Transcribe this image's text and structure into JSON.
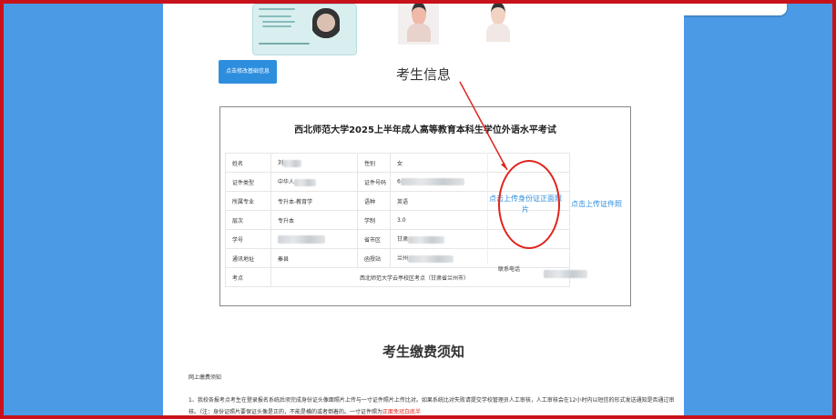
{
  "section_title": "考生信息",
  "edit_button": "点击修改基础信息",
  "card_title": "西北师范大学2025上半年成人高等教育本科生学位外语水平考试",
  "rows": [
    {
      "l1": "姓名",
      "v1": "刘",
      "l2": "性别",
      "v2": "女"
    },
    {
      "l1": "证件类型",
      "v1": "中华人",
      "l2": "证件号码",
      "v2": "6"
    },
    {
      "l1": "所属专业",
      "v1": "专升本-教育学",
      "l2": "语种",
      "v2": "英语"
    },
    {
      "l1": "层次",
      "v1": "专升本",
      "l2": "学制",
      "v2": "3.0"
    },
    {
      "l1": "学号",
      "v1": "",
      "l2": "省市区",
      "v2": "甘肃"
    },
    {
      "l1": "通讯地址",
      "v1": "秦县",
      "l2": "函授站",
      "v2": "兰州"
    }
  ],
  "phone_label": "联系电话",
  "exam_site_label": "考点",
  "exam_site_value": "西北师范大学云亭校区考点（甘肃省兰州市）",
  "upload_id_card": "点击上传身份证正面照片",
  "upload_id_photo": "点击上传证件照",
  "fee_title": "考生缴费须知",
  "notice_head": "网上缴费须知",
  "notice_text": "1、我校各报考点考生在登录报名系统后须完成身份证头像面照片上传与一寸证件照片上传比对。如果系统比对失败请提交学校管理员人工审核，人工审核会在12小时内以短信的形式发送通知是否通过审核。（注：身份证照片要保证头像是正的，不能是横的或者倒着的。一寸证件照为",
  "notice_red": "正面免冠白底半",
  "colors": {
    "accent": "#2e8ede",
    "annotation": "#e0231c",
    "background": "#4a9ae6"
  }
}
